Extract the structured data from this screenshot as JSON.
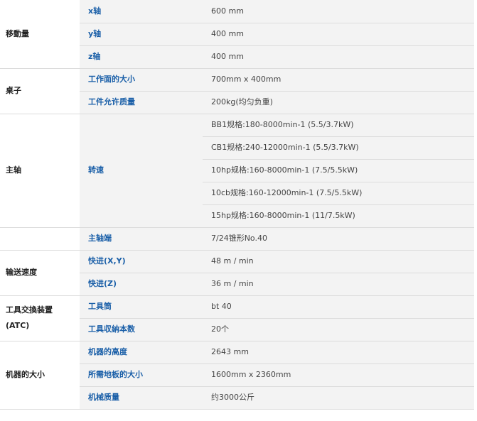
{
  "colors": {
    "item_label": "#1a5fa8",
    "category_label": "#222222",
    "value_text": "#444444",
    "row_bg": "#f3f3f3",
    "divider": "#dcdcdc"
  },
  "rows": [
    {
      "category": "移動量",
      "span": 3,
      "items": [
        {
          "label": "x轴",
          "value": "600 mm"
        },
        {
          "label": "y轴",
          "value": "400 mm"
        },
        {
          "label": "z轴",
          "value": "400 mm"
        }
      ]
    },
    {
      "category": "桌子",
      "span": 2,
      "items": [
        {
          "label": "工作面的大小",
          "value": "700mm x 400mm"
        },
        {
          "label": "工件允许质量",
          "value": "200kg(均匀负重)"
        }
      ]
    },
    {
      "category": "主轴",
      "span": 5,
      "items": [
        {
          "label": "转速",
          "values": [
            "BB1规格:180-8000min-1 (5.5/3.7kW)",
            "CB1规格:240-12000min-1 (5.5/3.7kW)",
            "10hp规格:160-8000min-1 (7.5/5.5kW)",
            "10cb规格:160-12000min-1 (7.5/5.5kW)",
            "15hp规格:160-8000min-1 (11/7.5kW)"
          ]
        }
      ]
    },
    {
      "category": "",
      "span": 1,
      "items": [
        {
          "label": "主轴端",
          "value": "7/24锥形No.40"
        }
      ]
    },
    {
      "category": "输送速度",
      "span": 2,
      "items": [
        {
          "label": "快进(X,Y)",
          "value": "48 m / min"
        },
        {
          "label": "快进(Z)",
          "value": "36 m / min"
        }
      ]
    },
    {
      "category_lines": [
        "工具交換装置",
        "(ATC)"
      ],
      "span": 2,
      "items": [
        {
          "label": "工具筒",
          "value": "bt 40"
        },
        {
          "label": "工具収納本数",
          "value": "20个"
        }
      ]
    },
    {
      "category": "机器的大小",
      "span": 3,
      "items": [
        {
          "label": "机器的高度",
          "value": "2643 mm"
        },
        {
          "label": "所需地板的大小",
          "value": "1600mm x 2360mm"
        },
        {
          "label": "机械质量",
          "value": "约3000公斤"
        }
      ]
    }
  ]
}
